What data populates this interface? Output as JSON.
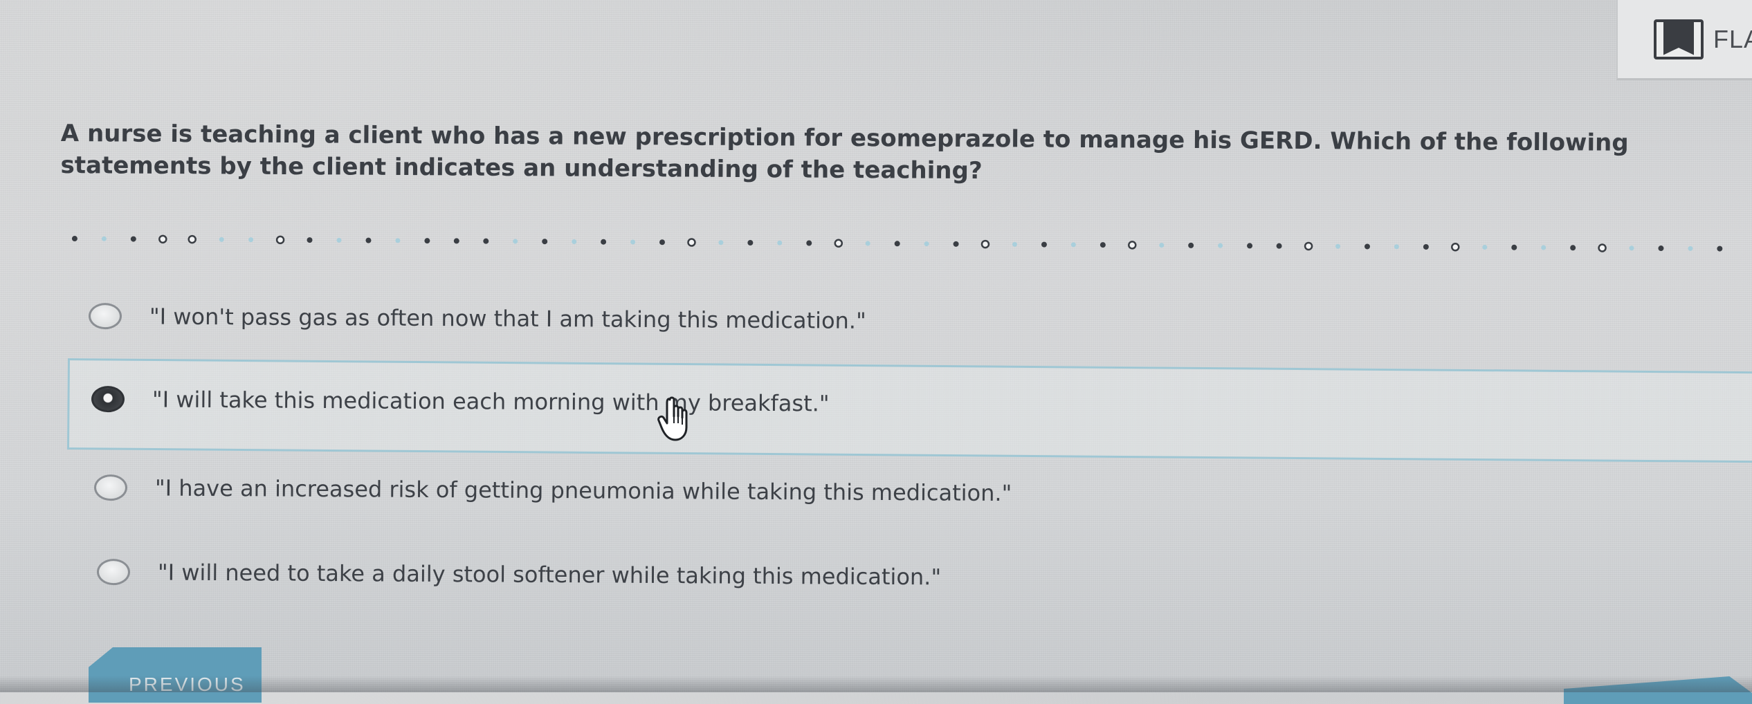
{
  "header": {
    "flag_label": "FLA",
    "flag_icon": "bookmark-flag-icon"
  },
  "question": {
    "text": "A nurse is teaching a client who has a new prescription for esomeprazole to manage his GERD. Which of the following statements by the client indicates an understanding of the teaching?"
  },
  "options": [
    {
      "label": "\"I won't pass gas as often now that I am taking this medication.\"",
      "selected": false
    },
    {
      "label": "\"I will take this medication each morning with my breakfast.\"",
      "selected": true
    },
    {
      "label": "\"I have an increased risk of getting pneumonia while taking this medication.\"",
      "selected": false
    },
    {
      "label": "\"I will need to take a daily stool softener while taking this medication.\"",
      "selected": false
    }
  ],
  "navigation": {
    "previous_label": "PREVIOUS",
    "next_label": ""
  },
  "colors": {
    "text": "#3b3f45",
    "accent_button": "#5f9db8",
    "selected_border": "#9fc7d4"
  },
  "cursor": "hand-pointer-icon"
}
